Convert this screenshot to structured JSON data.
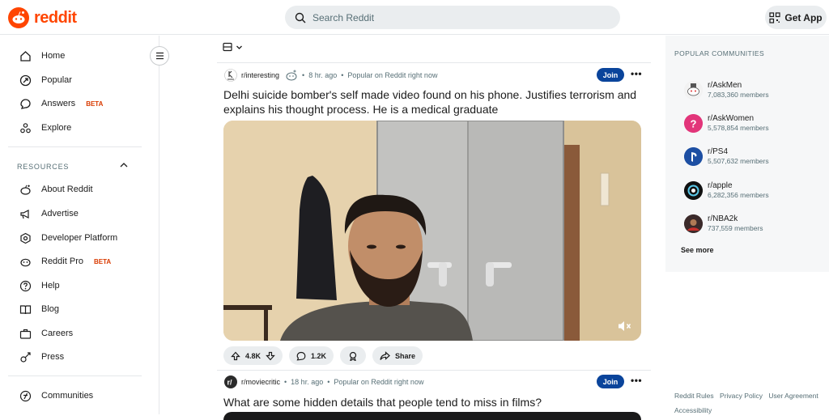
{
  "header": {
    "logo_text": "reddit",
    "search_placeholder": "Search Reddit",
    "get_app_label": "Get App"
  },
  "sidebar": {
    "main_items": [
      {
        "label": "Home",
        "icon": "home-icon"
      },
      {
        "label": "Popular",
        "icon": "popular-icon"
      },
      {
        "label": "Answers",
        "icon": "answers-icon",
        "badge": "BETA"
      },
      {
        "label": "Explore",
        "icon": "explore-icon"
      }
    ],
    "resources_heading": "RESOURCES",
    "resource_items": [
      {
        "label": "About Reddit",
        "icon": "reddit-alien-icon"
      },
      {
        "label": "Advertise",
        "icon": "megaphone-icon"
      },
      {
        "label": "Developer Platform",
        "icon": "developer-icon"
      },
      {
        "label": "Reddit Pro",
        "icon": "reddit-pro-icon",
        "badge": "BETA"
      },
      {
        "label": "Help",
        "icon": "help-icon"
      },
      {
        "label": "Blog",
        "icon": "blog-icon"
      },
      {
        "label": "Careers",
        "icon": "careers-icon"
      },
      {
        "label": "Press",
        "icon": "press-icon"
      }
    ],
    "communities_label": "Communities"
  },
  "posts": [
    {
      "subreddit": "r/interesting",
      "time": "8 hr. ago",
      "popular_note": "Popular on Reddit right now",
      "join_label": "Join",
      "title": "Delhi suicide bomber's self made video found on his phone. Justifies terrorism and explains his thought process. He is a medical graduate",
      "upvotes": "4.8K",
      "comments": "1.2K",
      "share_label": "Share"
    },
    {
      "subreddit": "r/moviecritic",
      "time": "18 hr. ago",
      "popular_note": "Popular on Reddit right now",
      "join_label": "Join",
      "title": "What are some hidden details that people tend to miss in films?"
    }
  ],
  "right": {
    "heading": "POPULAR COMMUNITIES",
    "communities": [
      {
        "name": "r/AskMen",
        "members": "7,083,360 members",
        "color": "#e8e8e8"
      },
      {
        "name": "r/AskWomen",
        "members": "5,578,854 members",
        "color": "#e2357a"
      },
      {
        "name": "r/PS4",
        "members": "5,507,632 members",
        "color": "#1d4fa3"
      },
      {
        "name": "r/apple",
        "members": "6,282,356 members",
        "color": "#111111"
      },
      {
        "name": "r/NBA2k",
        "members": "737,559 members",
        "color": "#3b2a2a"
      }
    ],
    "see_more": "See more",
    "footer_links": [
      "Reddit Rules",
      "Privacy Policy",
      "User Agreement",
      "Accessibility"
    ]
  },
  "colors": {
    "brand": "#ff4500",
    "join_button": "#0a449b",
    "beta_badge": "#d93a00"
  }
}
